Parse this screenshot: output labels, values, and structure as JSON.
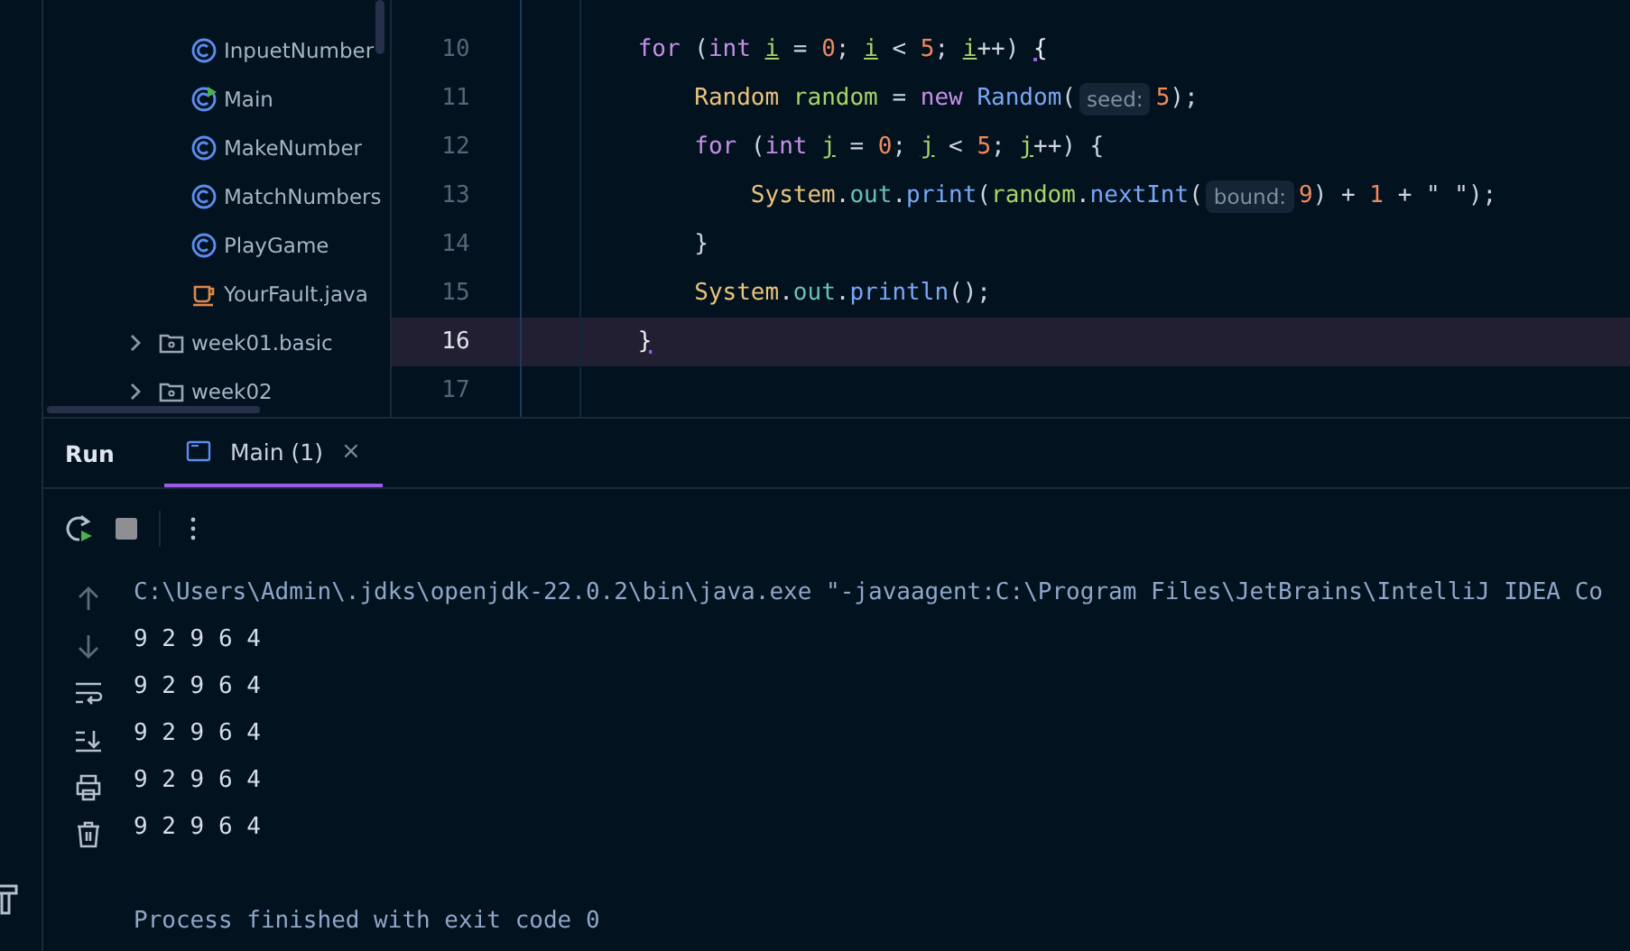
{
  "project_tree": {
    "items": [
      {
        "kind": "class",
        "label": "InpuetNumber"
      },
      {
        "kind": "run-class",
        "label": "Main"
      },
      {
        "kind": "class",
        "label": "MakeNumber"
      },
      {
        "kind": "class",
        "label": "MatchNumbers"
      },
      {
        "kind": "class",
        "label": "PlayGame"
      },
      {
        "kind": "java-file",
        "label": "YourFault.java"
      },
      {
        "kind": "folder",
        "label": "week01.basic",
        "expanded": false
      },
      {
        "kind": "folder",
        "label": "week02",
        "expanded": false
      }
    ]
  },
  "editor": {
    "lines": [
      {
        "number": "10",
        "current": false,
        "tokens": [
          {
            "kind": "keyword",
            "text": "    for"
          },
          {
            "kind": "plain",
            "text": " ("
          },
          {
            "kind": "keyword",
            "text": "int "
          },
          {
            "kind": "loop-var",
            "text": "i"
          },
          {
            "kind": "plain",
            "text": " = "
          },
          {
            "kind": "number",
            "text": "0"
          },
          {
            "kind": "plain",
            "text": "; "
          },
          {
            "kind": "loop-var",
            "text": "i"
          },
          {
            "kind": "plain",
            "text": " < "
          },
          {
            "kind": "number",
            "text": "5"
          },
          {
            "kind": "plain",
            "text": "; "
          },
          {
            "kind": "loop-var",
            "text": "i"
          },
          {
            "kind": "plain",
            "text": "++) "
          },
          {
            "kind": "brace-match",
            "text": "{"
          }
        ]
      },
      {
        "number": "11",
        "current": false,
        "tokens": [
          {
            "kind": "type",
            "text": "        Random "
          },
          {
            "kind": "local",
            "text": "random"
          },
          {
            "kind": "plain",
            "text": " = "
          },
          {
            "kind": "keyword",
            "text": "new "
          },
          {
            "kind": "method",
            "text": "Random"
          },
          {
            "kind": "plain",
            "text": "("
          },
          {
            "kind": "hint",
            "text": "seed:"
          },
          {
            "kind": "number",
            "text": "5"
          },
          {
            "kind": "plain",
            "text": ");"
          }
        ]
      },
      {
        "number": "12",
        "current": false,
        "tokens": [
          {
            "kind": "keyword",
            "text": "        for"
          },
          {
            "kind": "plain",
            "text": " ("
          },
          {
            "kind": "keyword",
            "text": "int "
          },
          {
            "kind": "loop-var",
            "text": "j"
          },
          {
            "kind": "plain",
            "text": " = "
          },
          {
            "kind": "number",
            "text": "0"
          },
          {
            "kind": "plain",
            "text": "; "
          },
          {
            "kind": "loop-var",
            "text": "j"
          },
          {
            "kind": "plain",
            "text": " < "
          },
          {
            "kind": "number",
            "text": "5"
          },
          {
            "kind": "plain",
            "text": "; "
          },
          {
            "kind": "loop-var",
            "text": "j"
          },
          {
            "kind": "plain",
            "text": "++) {"
          }
        ]
      },
      {
        "number": "13",
        "current": false,
        "tokens": [
          {
            "kind": "type",
            "text": "            System"
          },
          {
            "kind": "plain",
            "text": "."
          },
          {
            "kind": "field",
            "text": "out"
          },
          {
            "kind": "plain",
            "text": "."
          },
          {
            "kind": "method",
            "text": "print"
          },
          {
            "kind": "plain",
            "text": "("
          },
          {
            "kind": "local",
            "text": "random"
          },
          {
            "kind": "plain",
            "text": "."
          },
          {
            "kind": "method",
            "text": "nextInt"
          },
          {
            "kind": "plain",
            "text": "("
          },
          {
            "kind": "hint",
            "text": "bound:"
          },
          {
            "kind": "number",
            "text": "9"
          },
          {
            "kind": "plain",
            "text": ") + "
          },
          {
            "kind": "number",
            "text": "1"
          },
          {
            "kind": "plain",
            "text": " + \" \");"
          }
        ]
      },
      {
        "number": "14",
        "current": false,
        "tokens": [
          {
            "kind": "plain",
            "text": "        }"
          }
        ]
      },
      {
        "number": "15",
        "current": false,
        "tokens": [
          {
            "kind": "type",
            "text": "        System"
          },
          {
            "kind": "plain",
            "text": "."
          },
          {
            "kind": "field",
            "text": "out"
          },
          {
            "kind": "plain",
            "text": "."
          },
          {
            "kind": "method",
            "text": "println"
          },
          {
            "kind": "plain",
            "text": "();"
          }
        ]
      },
      {
        "number": "16",
        "current": true,
        "tokens": [
          {
            "kind": "brace-match",
            "text": "    }"
          }
        ]
      },
      {
        "number": "17",
        "current": false
      }
    ]
  },
  "run_panel": {
    "title": "Run",
    "tabs": [
      {
        "label": "Main (1)",
        "selected": true,
        "close": "×"
      }
    ],
    "console": [
      {
        "kind": "command",
        "text": "C:\\Users\\Admin\\.jdks\\openjdk-22.0.2\\bin\\java.exe \"-javaagent:C:\\Program Files\\JetBrains\\IntelliJ IDEA Co"
      },
      {
        "kind": "output",
        "text": "9 2 9 6 4"
      },
      {
        "kind": "output",
        "text": "9 2 9 6 4"
      },
      {
        "kind": "output",
        "text": "9 2 9 6 4"
      },
      {
        "kind": "output",
        "text": "9 2 9 6 4"
      },
      {
        "kind": "output",
        "text": "9 2 9 6 4"
      },
      {
        "kind": "blank"
      },
      {
        "kind": "system",
        "text": "Process finished with exit code 0"
      }
    ]
  }
}
